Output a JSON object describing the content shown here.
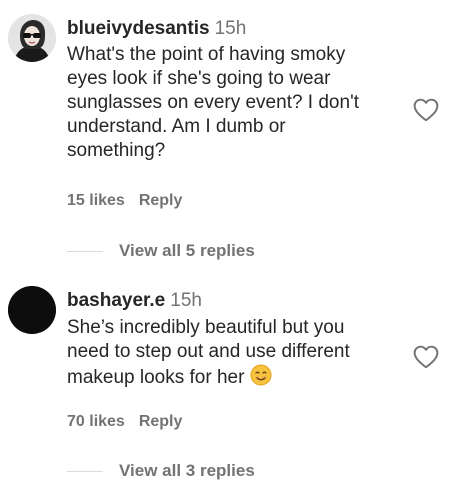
{
  "comments": [
    {
      "username": "blueivydesantis",
      "time": "15h",
      "lines": [
        "What's the point of having smoky",
        "eyes look if she's going to wear",
        "sunglasses on every event? I don't",
        "understand. Am I dumb or",
        "something?"
      ],
      "likes": "15 likes",
      "reply": "Reply",
      "view_replies": "View all 5 replies",
      "avatar_icon": "user-photo-avatar",
      "like_icon": "heart-outline-icon"
    },
    {
      "username": "bashayer.e",
      "time": "15h",
      "lines": [
        "She’s incredibly beautiful but you",
        "need to step out and use different",
        "makeup looks for her"
      ],
      "emoji": "smiling-face-emoji",
      "likes": "70 likes",
      "reply": "Reply",
      "view_replies": "View all 3 replies",
      "avatar_icon": "black-avatar",
      "like_icon": "heart-outline-icon"
    }
  ],
  "colors": {
    "text": "#262626",
    "secondary": "#737373",
    "divider": "#dbdbdb",
    "emoji": "#f7c23c"
  }
}
